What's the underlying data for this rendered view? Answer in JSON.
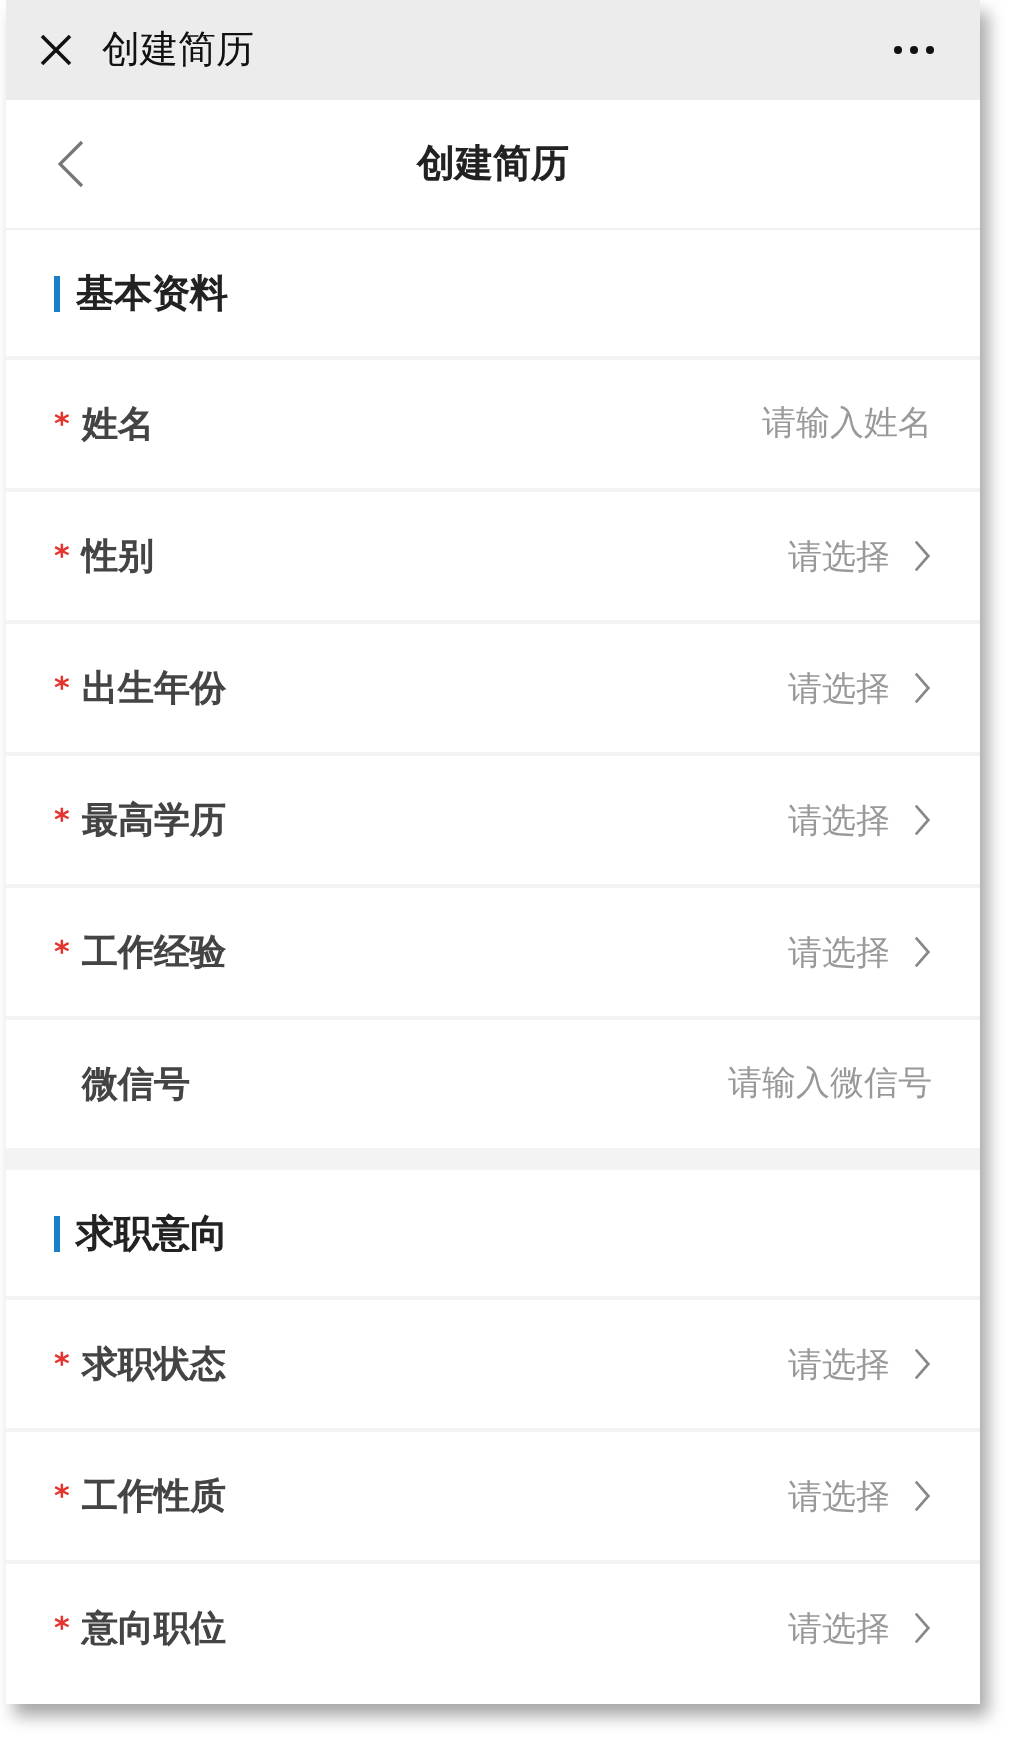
{
  "window": {
    "title": "创建简历"
  },
  "nav": {
    "title": "创建简历"
  },
  "sections": [
    {
      "title": "基本资料",
      "fields": [
        {
          "label": "姓名",
          "marker": "*",
          "kind": "input",
          "placeholder": "请输入姓名"
        },
        {
          "label": "性别",
          "marker": "*",
          "kind": "select",
          "value": "请选择"
        },
        {
          "label": "出生年份",
          "marker": "*",
          "kind": "select",
          "value": "请选择"
        },
        {
          "label": "最高学历",
          "marker": "*",
          "kind": "select",
          "value": "请选择"
        },
        {
          "label": "工作经验",
          "marker": "*",
          "kind": "select",
          "value": "请选择"
        },
        {
          "label": "微信号",
          "kind": "input",
          "placeholder": "请输入微信号"
        }
      ]
    },
    {
      "title": "求职意向",
      "fields": [
        {
          "label": "求职状态",
          "marker": "*",
          "kind": "select",
          "value": "请选择"
        },
        {
          "label": "工作性质",
          "marker": "*",
          "kind": "select",
          "value": "请选择"
        },
        {
          "label": "意向职位",
          "marker": "*",
          "kind": "select",
          "value": "请选择"
        }
      ]
    }
  ]
}
